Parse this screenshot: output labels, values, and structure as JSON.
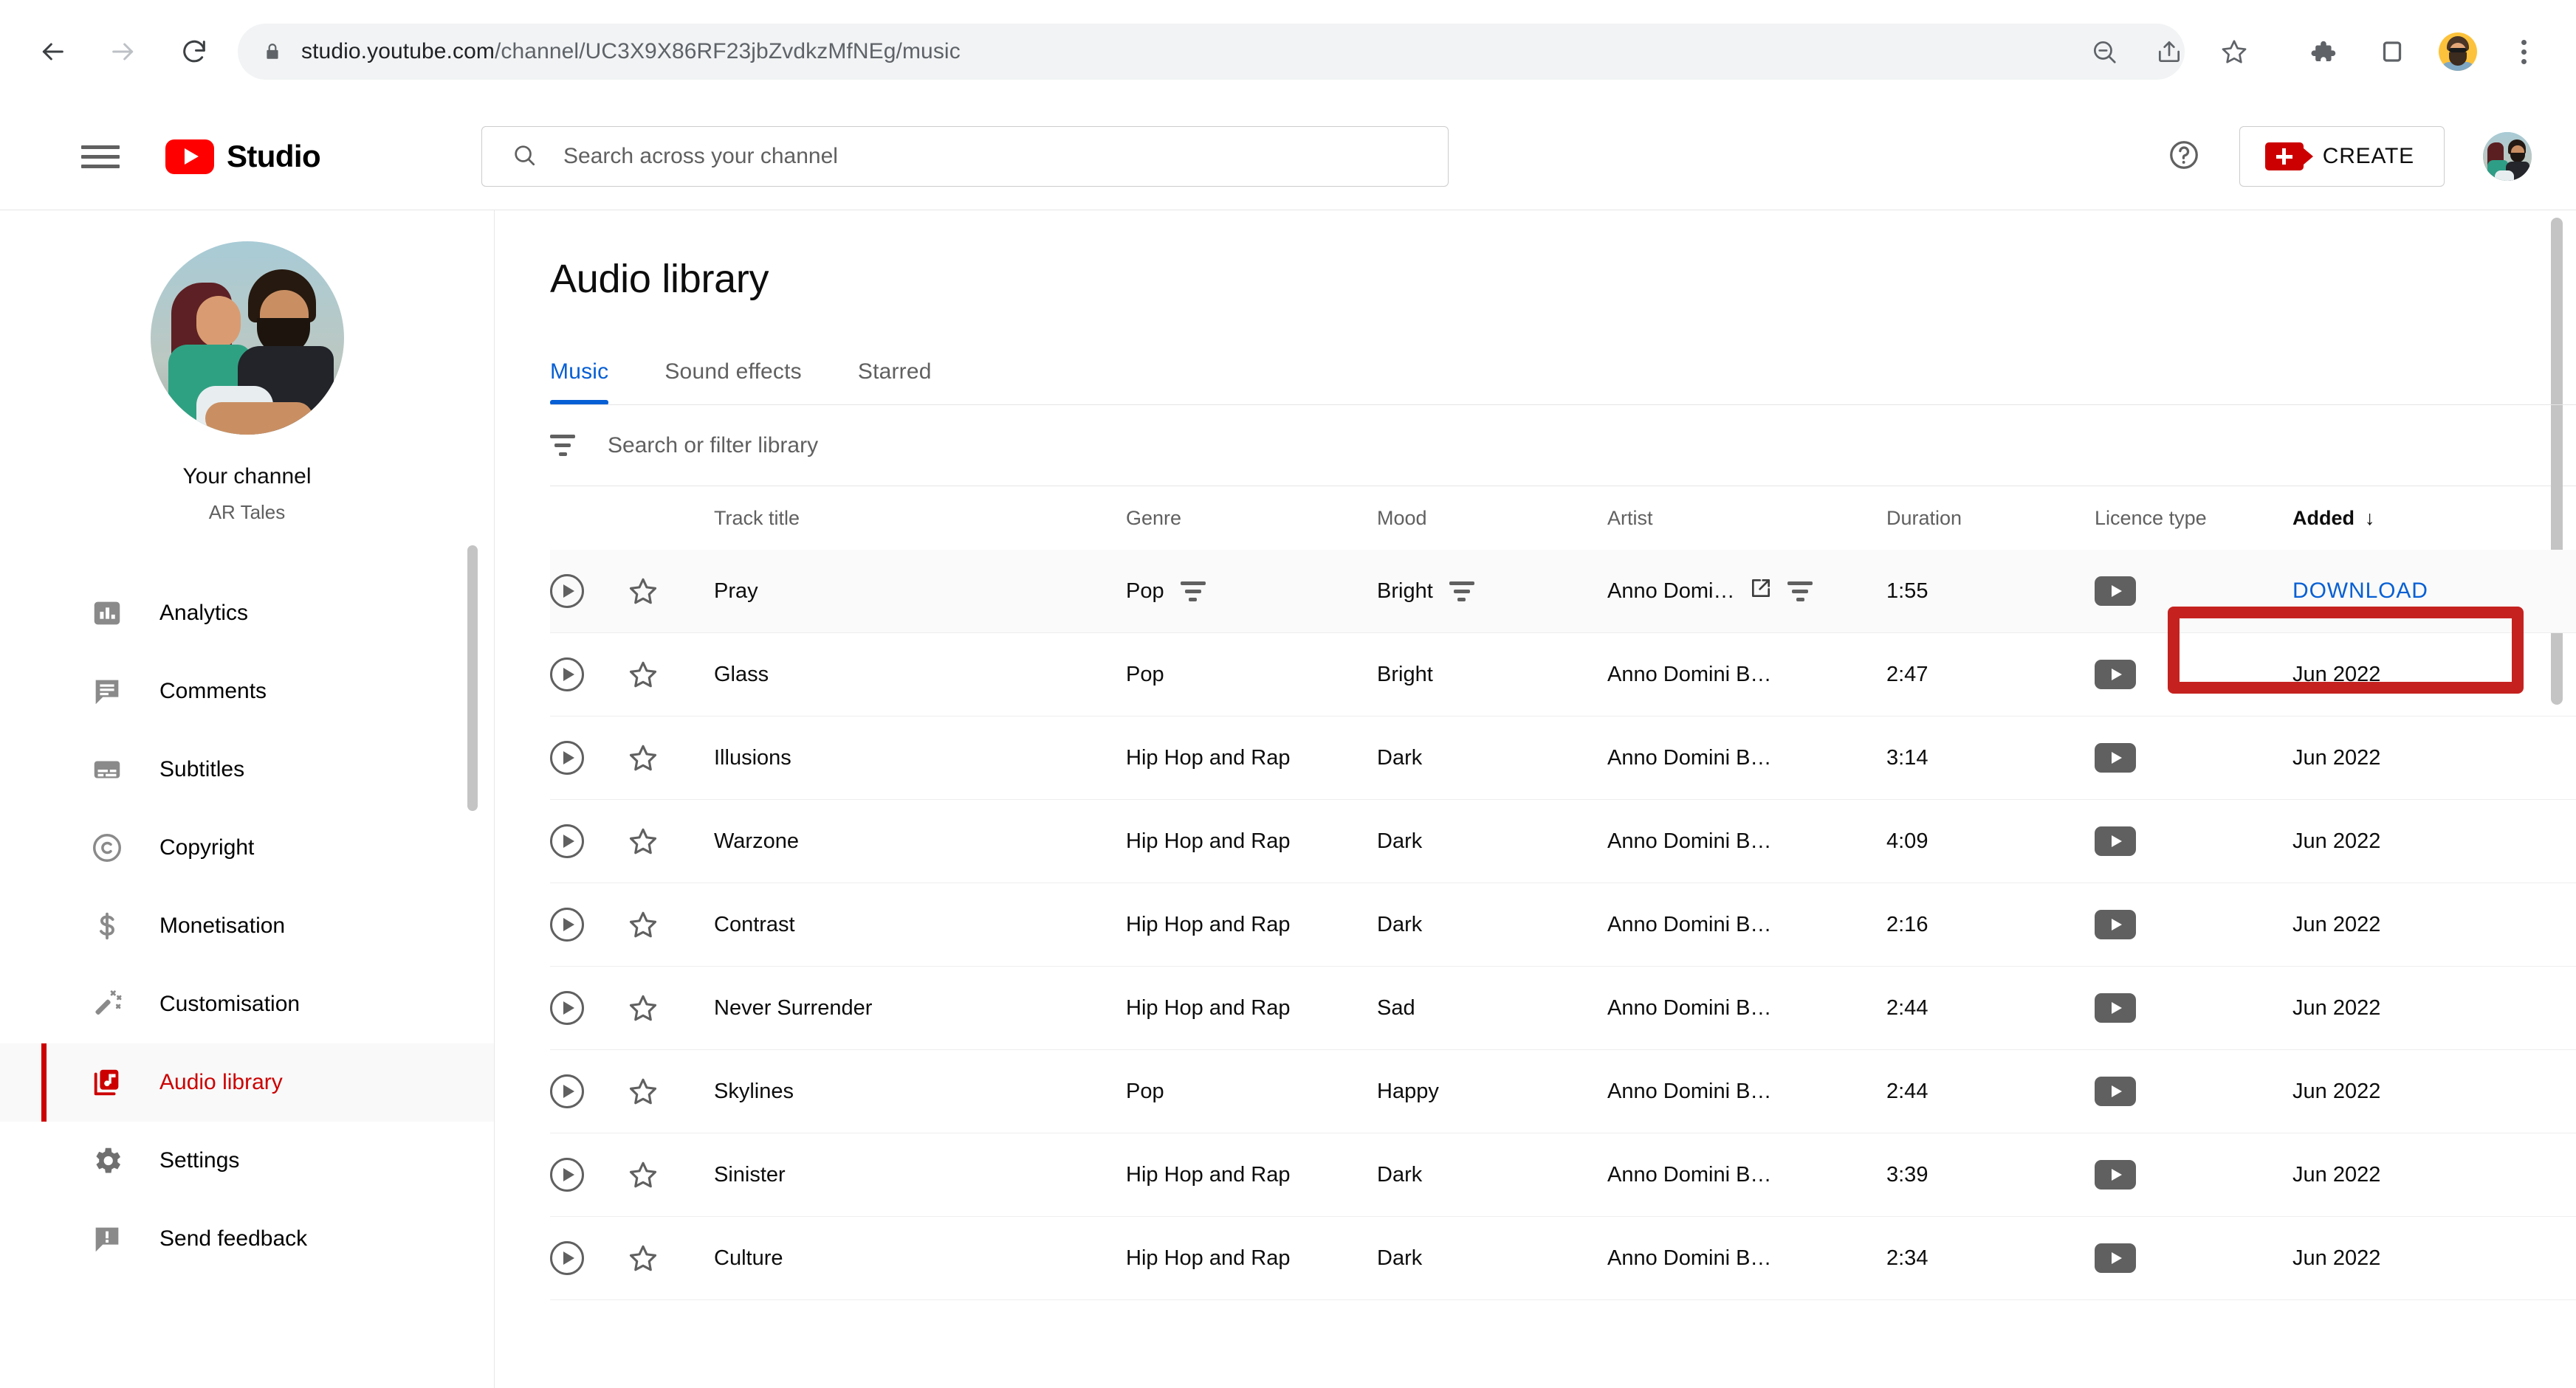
{
  "browser": {
    "url_host": "studio.youtube.com",
    "url_path": "/channel/UC3X9X86RF23jbZvdkzMfNEg/music",
    "icons": {
      "back": "back-arrow-icon",
      "forward": "forward-arrow-icon",
      "reload": "reload-icon",
      "lock": "lock-icon",
      "zoom_out": "zoom-out-icon",
      "share": "share-icon",
      "bookmark": "bookmark-star-icon",
      "extensions": "puzzle-extensions-icon",
      "side_panel": "side-panel-icon",
      "profile": "chrome-profile-avatar",
      "menu": "three-dot-menu-icon"
    }
  },
  "studio_header": {
    "menu_label": "hamburger-menu",
    "logo_text": "Studio",
    "search_placeholder": "Search across your channel",
    "help_label": "help-icon",
    "create_label": "CREATE",
    "avatar_label": "account-avatar"
  },
  "sidebar": {
    "your_channel": "Your channel",
    "channel_name": "AR Tales",
    "items": [
      {
        "label": "Analytics",
        "icon": "analytics-bar-chart-icon",
        "active": false
      },
      {
        "label": "Comments",
        "icon": "comments-bubble-icon",
        "active": false
      },
      {
        "label": "Subtitles",
        "icon": "subtitles-icon",
        "active": false
      },
      {
        "label": "Copyright",
        "icon": "copyright-icon",
        "active": false
      },
      {
        "label": "Monetisation",
        "icon": "dollar-sign-icon",
        "active": false
      },
      {
        "label": "Customisation",
        "icon": "magic-wand-icon",
        "active": false
      },
      {
        "label": "Audio library",
        "icon": "audio-library-icon",
        "active": true
      },
      {
        "label": "Settings",
        "icon": "gear-icon",
        "active": false
      },
      {
        "label": "Send feedback",
        "icon": "feedback-icon",
        "active": false
      }
    ]
  },
  "main": {
    "title": "Audio library",
    "tabs": [
      {
        "label": "Music",
        "active": true
      },
      {
        "label": "Sound effects",
        "active": false
      },
      {
        "label": "Starred",
        "active": false
      }
    ],
    "filter_placeholder": "Search or filter library",
    "filter_value": "",
    "columns": {
      "track_title": "Track title",
      "genre": "Genre",
      "mood": "Mood",
      "artist": "Artist",
      "duration": "Duration",
      "licence_type": "Licence type",
      "added": "Added",
      "sort_arrow": "↓"
    },
    "download_label": "DOWNLOAD",
    "highlight_color": "#c5221f",
    "link_color": "#065fd4",
    "rows": [
      {
        "title": "Pray",
        "genre": "Pop",
        "mood": "Bright",
        "artist": "Anno Domi…",
        "duration": "1:55",
        "licence": "youtube-licence-icon",
        "added": "DOWNLOAD",
        "hovered": true
      },
      {
        "title": "Glass",
        "genre": "Pop",
        "mood": "Bright",
        "artist": "Anno Domini B…",
        "duration": "2:47",
        "licence": "youtube-licence-icon",
        "added": "Jun 2022",
        "hovered": false
      },
      {
        "title": "Illusions",
        "genre": "Hip Hop and Rap",
        "mood": "Dark",
        "artist": "Anno Domini B…",
        "duration": "3:14",
        "licence": "youtube-licence-icon",
        "added": "Jun 2022",
        "hovered": false
      },
      {
        "title": "Warzone",
        "genre": "Hip Hop and Rap",
        "mood": "Dark",
        "artist": "Anno Domini B…",
        "duration": "4:09",
        "licence": "youtube-licence-icon",
        "added": "Jun 2022",
        "hovered": false
      },
      {
        "title": "Contrast",
        "genre": "Hip Hop and Rap",
        "mood": "Dark",
        "artist": "Anno Domini B…",
        "duration": "2:16",
        "licence": "youtube-licence-icon",
        "added": "Jun 2022",
        "hovered": false
      },
      {
        "title": "Never Surrender",
        "genre": "Hip Hop and Rap",
        "mood": "Sad",
        "artist": "Anno Domini B…",
        "duration": "2:44",
        "licence": "youtube-licence-icon",
        "added": "Jun 2022",
        "hovered": false
      },
      {
        "title": "Skylines",
        "genre": "Pop",
        "mood": "Happy",
        "artist": "Anno Domini B…",
        "duration": "2:44",
        "licence": "youtube-licence-icon",
        "added": "Jun 2022",
        "hovered": false
      },
      {
        "title": "Sinister",
        "genre": "Hip Hop and Rap",
        "mood": "Dark",
        "artist": "Anno Domini B…",
        "duration": "3:39",
        "licence": "youtube-licence-icon",
        "added": "Jun 2022",
        "hovered": false
      },
      {
        "title": "Culture",
        "genre": "Hip Hop and Rap",
        "mood": "Dark",
        "artist": "Anno Domini B…",
        "duration": "2:34",
        "licence": "youtube-licence-icon",
        "added": "Jun 2022",
        "hovered": false
      }
    ]
  }
}
